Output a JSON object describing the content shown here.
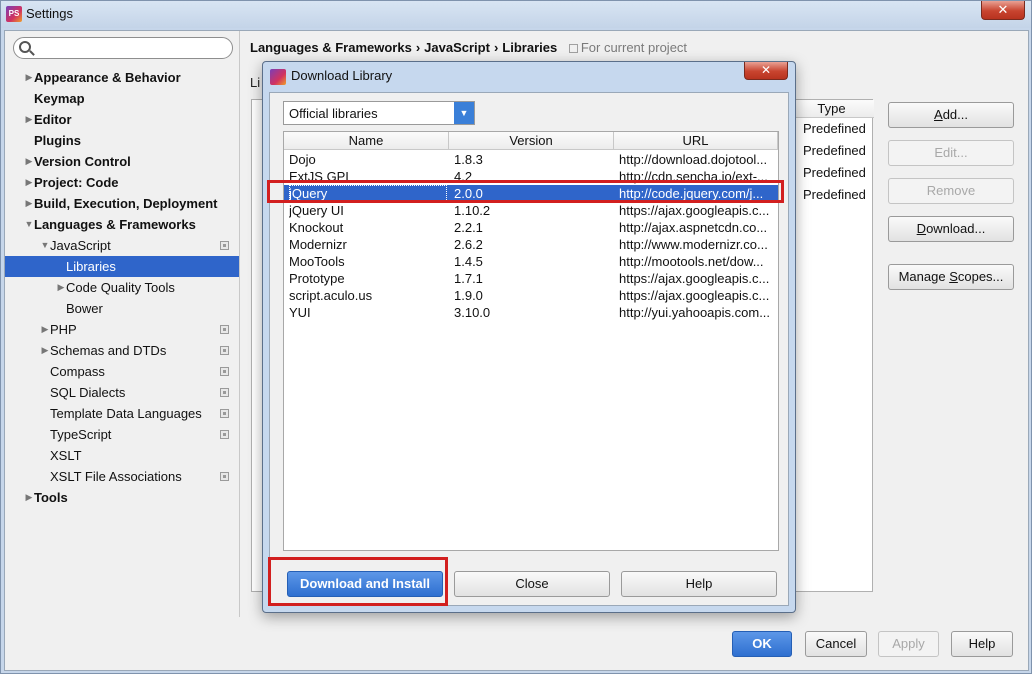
{
  "window": {
    "title": "Settings",
    "app_icon": "phpstorm-logo-icon",
    "close_glyph": "✕"
  },
  "search": {
    "placeholder": ""
  },
  "nav": {
    "items": [
      {
        "label": "Appearance & Behavior",
        "level": 0,
        "bold": true,
        "arrow": "▶"
      },
      {
        "label": "Keymap",
        "level": 0,
        "bold": true,
        "arrow": ""
      },
      {
        "label": "Editor",
        "level": 0,
        "bold": true,
        "arrow": "▶"
      },
      {
        "label": "Plugins",
        "level": 0,
        "bold": true,
        "arrow": ""
      },
      {
        "label": "Version Control",
        "level": 0,
        "bold": true,
        "arrow": "▶"
      },
      {
        "label": "Project: Code",
        "level": 0,
        "bold": true,
        "arrow": "▶"
      },
      {
        "label": "Build, Execution, Deployment",
        "level": 0,
        "bold": true,
        "arrow": "▶"
      },
      {
        "label": "Languages & Frameworks",
        "level": 0,
        "bold": true,
        "arrow": "▼"
      },
      {
        "label": "JavaScript",
        "level": 1,
        "bold": false,
        "arrow": "▼",
        "project": true
      },
      {
        "label": "Libraries",
        "level": 2,
        "bold": false,
        "arrow": "",
        "selected": true
      },
      {
        "label": "Code Quality Tools",
        "level": 2,
        "bold": false,
        "arrow": "▶"
      },
      {
        "label": "Bower",
        "level": 2,
        "bold": false,
        "arrow": ""
      },
      {
        "label": "PHP",
        "level": 1,
        "bold": false,
        "arrow": "▶",
        "project": true
      },
      {
        "label": "Schemas and DTDs",
        "level": 1,
        "bold": false,
        "arrow": "▶",
        "project": true
      },
      {
        "label": "Compass",
        "level": 1,
        "bold": false,
        "arrow": "",
        "project": true
      },
      {
        "label": "SQL Dialects",
        "level": 1,
        "bold": false,
        "arrow": "",
        "project": true
      },
      {
        "label": "Template Data Languages",
        "level": 1,
        "bold": false,
        "arrow": "",
        "project": true
      },
      {
        "label": "TypeScript",
        "level": 1,
        "bold": false,
        "arrow": "",
        "project": true
      },
      {
        "label": "XSLT",
        "level": 1,
        "bold": false,
        "arrow": ""
      },
      {
        "label": "XSLT File Associations",
        "level": 1,
        "bold": false,
        "arrow": "",
        "project": true
      },
      {
        "label": "Tools",
        "level": 0,
        "bold": true,
        "arrow": "▶"
      }
    ]
  },
  "breadcrumb": {
    "parts": [
      "Languages & Frameworks",
      "JavaScript",
      "Libraries"
    ],
    "separator": "›",
    "scope_note": "For current project"
  },
  "libraries_panel": {
    "caption": "Li",
    "col_type": "Type",
    "type_cells": [
      "Predefined",
      "Predefined",
      "Predefined",
      "Predefined"
    ]
  },
  "side_buttons": [
    {
      "label": "Add...",
      "mnemonic_index": 0,
      "enabled": true
    },
    {
      "label": "Edit...",
      "enabled": false
    },
    {
      "label": "Remove",
      "enabled": false
    },
    {
      "label": "Download...",
      "mnemonic_index": 0,
      "enabled": true
    },
    {
      "label": "Manage Scopes...",
      "enabled": true
    }
  ],
  "bottom_buttons": {
    "ok": "OK",
    "cancel": "Cancel",
    "apply": "Apply",
    "help": "Help"
  },
  "dialog": {
    "title": "Download Library",
    "close_glyph": "✕",
    "source_select": {
      "value": "Official libraries",
      "chevron": "▼"
    },
    "columns": [
      "Name",
      "Version",
      "URL"
    ],
    "rows": [
      {
        "name": "Dojo",
        "version": "1.8.3",
        "url": "http://download.dojotool..."
      },
      {
        "name": "ExtJS GPL",
        "version": "4.2",
        "url": "http://cdn.sencha.io/ext-..."
      },
      {
        "name": "jQuery",
        "version": "2.0.0",
        "url": "http://code.jquery.com/j...",
        "selected": true
      },
      {
        "name": "jQuery UI",
        "version": "1.10.2",
        "url": "https://ajax.googleapis.c..."
      },
      {
        "name": "Knockout",
        "version": "2.2.1",
        "url": "http://ajax.aspnetcdn.co..."
      },
      {
        "name": "Modernizr",
        "version": "2.6.2",
        "url": "http://www.modernizr.co..."
      },
      {
        "name": "MooTools",
        "version": "1.4.5",
        "url": "http://mootools.net/dow..."
      },
      {
        "name": "Prototype",
        "version": "1.7.1",
        "url": "https://ajax.googleapis.c..."
      },
      {
        "name": "script.aculo.us",
        "version": "1.9.0",
        "url": "https://ajax.googleapis.c..."
      },
      {
        "name": "YUI",
        "version": "3.10.0",
        "url": "http://yui.yahooapis.com..."
      }
    ],
    "buttons": {
      "download_install": "Download and Install",
      "close": "Close",
      "help": "Help"
    }
  },
  "colors": {
    "selection": "#2f65ca",
    "highlight": "#d21f1f",
    "primary_button": "#2e6fd0"
  }
}
